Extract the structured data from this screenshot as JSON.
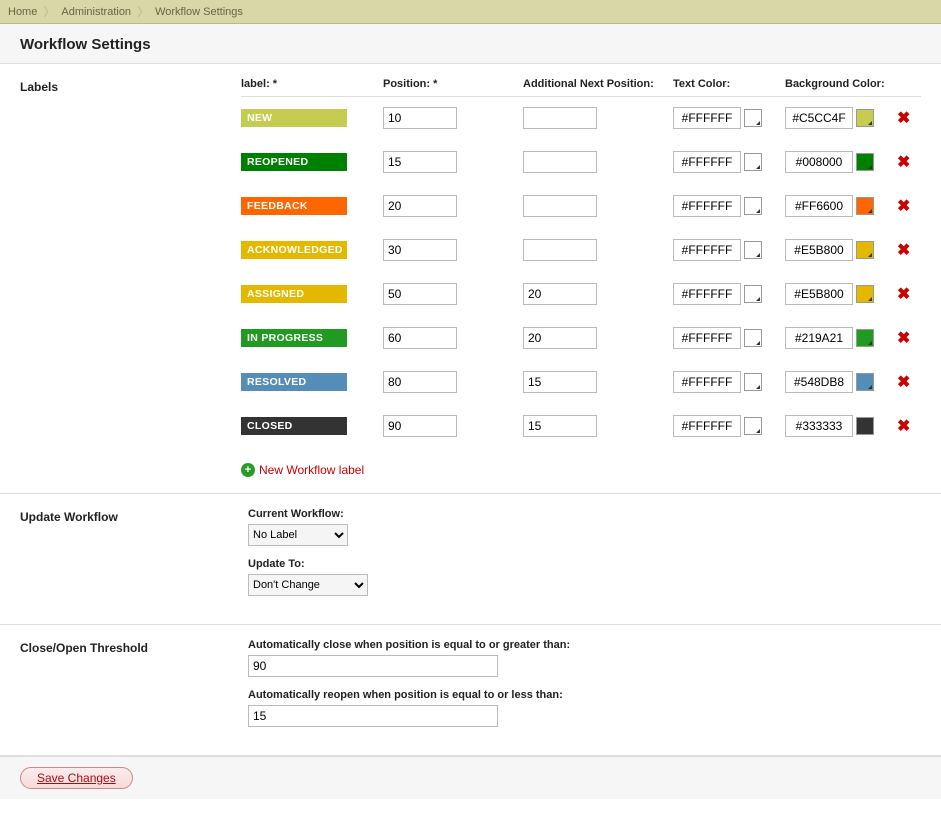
{
  "breadcrumb": {
    "items": [
      "Home",
      "Administration",
      "Workflow Settings"
    ]
  },
  "page_title": "Workflow Settings",
  "sections": {
    "labels": {
      "title": "Labels",
      "headers": {
        "label": "label: *",
        "position": "Position: *",
        "add_pos": "Additional Next Position:",
        "text_color": "Text Color:",
        "bg_color": "Background Color:"
      },
      "rows": [
        {
          "name": "NEW",
          "position": "10",
          "add_pos": "",
          "text_color": "#FFFFFF",
          "bg_color": "#C5CC4F"
        },
        {
          "name": "REOPENED",
          "position": "15",
          "add_pos": "",
          "text_color": "#FFFFFF",
          "bg_color": "#008000"
        },
        {
          "name": "FEEDBACK",
          "position": "20",
          "add_pos": "",
          "text_color": "#FFFFFF",
          "bg_color": "#FF6600"
        },
        {
          "name": "ACKNOWLEDGED",
          "position": "30",
          "add_pos": "",
          "text_color": "#FFFFFF",
          "bg_color": "#E5B800"
        },
        {
          "name": "ASSIGNED",
          "position": "50",
          "add_pos": "20",
          "text_color": "#FFFFFF",
          "bg_color": "#E5B800"
        },
        {
          "name": "IN PROGRESS",
          "position": "60",
          "add_pos": "20",
          "text_color": "#FFFFFF",
          "bg_color": "#219A21"
        },
        {
          "name": "RESOLVED",
          "position": "80",
          "add_pos": "15",
          "text_color": "#FFFFFF",
          "bg_color": "#548DB8"
        },
        {
          "name": "CLOSED",
          "position": "90",
          "add_pos": "15",
          "text_color": "#FFFFFF",
          "bg_color": "#333333"
        }
      ],
      "new_link": "New Workflow label"
    },
    "update": {
      "title": "Update Workflow",
      "current_label": "Current Workflow:",
      "current_value": "No Label",
      "update_to_label": "Update To:",
      "update_to_value": "Don't Change"
    },
    "threshold": {
      "title": "Close/Open Threshold",
      "close_label": "Automatically close when position is equal to or greater than:",
      "close_value": "90",
      "reopen_label": "Automatically reopen when position is equal to or less than:",
      "reopen_value": "15"
    }
  },
  "footer": {
    "save": "Save Changes"
  }
}
